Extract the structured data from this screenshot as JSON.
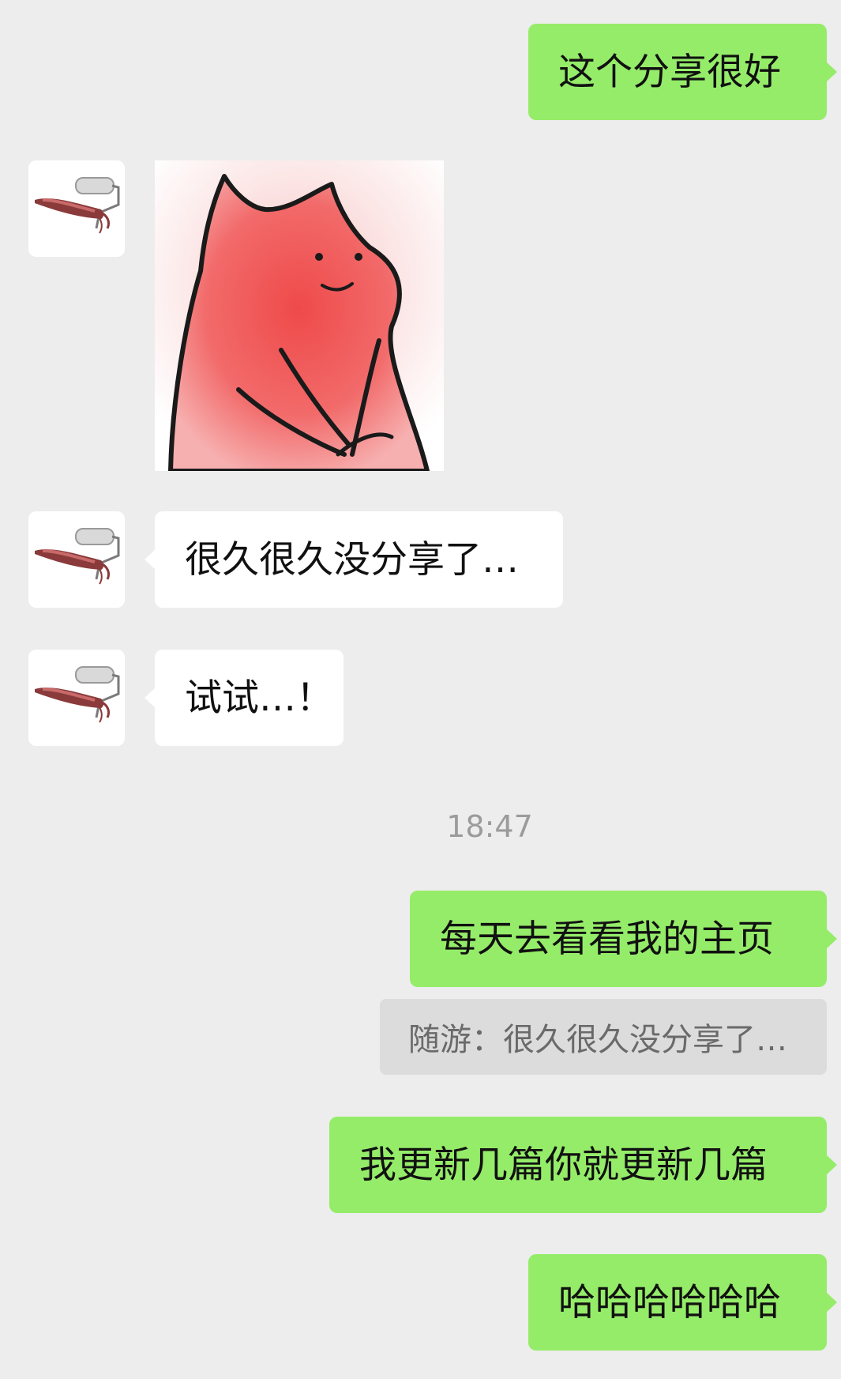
{
  "messages": {
    "m1": "这个分享很好",
    "m3": "很久很久没分享了…",
    "m4": "试试…！",
    "m5": "每天去看看我的主页",
    "m6": "我更新几篇你就更新几篇",
    "m7": "哈哈哈哈哈哈"
  },
  "timestamp": "18:47",
  "quote": {
    "text": "随游：很久很久没分享了…"
  },
  "colors": {
    "background": "#ededed",
    "me_bubble": "#95ec69",
    "them_bubble": "#ffffff",
    "quote_bg": "#dcdcdc"
  },
  "icons": {
    "avatar": "squid-paint-roller-avatar",
    "sticker": "blushing-cat-sticker"
  }
}
